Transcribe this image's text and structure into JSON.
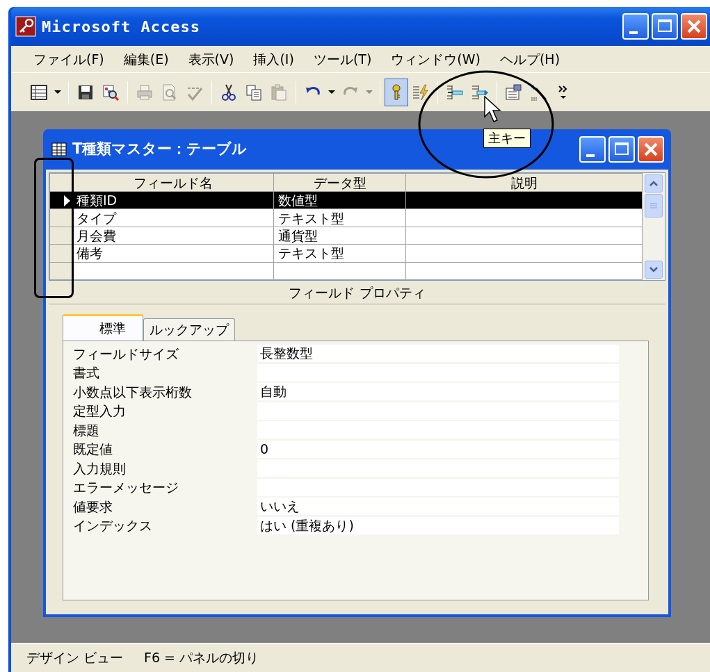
{
  "window": {
    "title": "Microsoft Access"
  },
  "menu": [
    "ファイル(F)",
    "編集(E)",
    "表示(V)",
    "挿入(I)",
    "ツール(T)",
    "ウィンドウ(W)",
    "ヘルプ(H)"
  ],
  "toolbar": [
    {
      "kind": "view"
    },
    {
      "kind": "dropdown"
    },
    {
      "kind": "separator"
    },
    {
      "kind": "save"
    },
    {
      "kind": "search"
    },
    {
      "kind": "separator"
    },
    {
      "kind": "print",
      "disabled": true
    },
    {
      "kind": "preview",
      "disabled": true
    },
    {
      "kind": "spell",
      "disabled": true
    },
    {
      "kind": "separator"
    },
    {
      "kind": "cut"
    },
    {
      "kind": "copy"
    },
    {
      "kind": "paste",
      "disabled": true
    },
    {
      "kind": "separator"
    },
    {
      "kind": "undo"
    },
    {
      "kind": "dropdown"
    },
    {
      "kind": "redo",
      "disabled": true
    },
    {
      "kind": "dropdown",
      "disabled": true
    },
    {
      "kind": "separator"
    },
    {
      "kind": "key",
      "selected": true
    },
    {
      "kind": "index",
      "selected": false
    },
    {
      "kind": "separator"
    },
    {
      "kind": "insert"
    },
    {
      "kind": "delete"
    },
    {
      "kind": "separator"
    },
    {
      "kind": "properties"
    },
    {
      "kind": "build"
    },
    {
      "kind": "more"
    }
  ],
  "tooltip": "主キー",
  "table_window": {
    "title": "T種類マスター：テーブル",
    "columns": [
      "フィールド名",
      "データ型",
      "説明"
    ],
    "rows": [
      {
        "field": "種類ID",
        "type": "数値型",
        "selected": true
      },
      {
        "field": "タイプ",
        "type": "テキスト型",
        "selected": false
      },
      {
        "field": "月会費",
        "type": "通貨型",
        "selected": false
      },
      {
        "field": "備考",
        "type": "テキスト型",
        "selected": false
      },
      {
        "selected": false
      }
    ],
    "properties_title": "フィールド プロパティ",
    "tabs": [
      {
        "label": "標準",
        "selected": true
      },
      {
        "label": "ルックアップ",
        "selected": false
      }
    ],
    "properties": [
      {
        "label": "フィールドサイズ",
        "value": "長整数型"
      },
      {
        "label": "書式"
      },
      {
        "label": "小数点以下表示桁数",
        "value": "自動"
      },
      {
        "label": "定型入力"
      },
      {
        "label": "標題"
      },
      {
        "label": "既定値",
        "value": "0"
      },
      {
        "label": "入力規則"
      },
      {
        "label": "エラーメッセージ"
      },
      {
        "label": "値要求",
        "value": "いいえ"
      },
      {
        "label": "インデックス",
        "value": "はい (重複あり)"
      }
    ]
  },
  "status_bar": [
    "デザイン ビュー",
    "F6 = パネルの切り"
  ]
}
